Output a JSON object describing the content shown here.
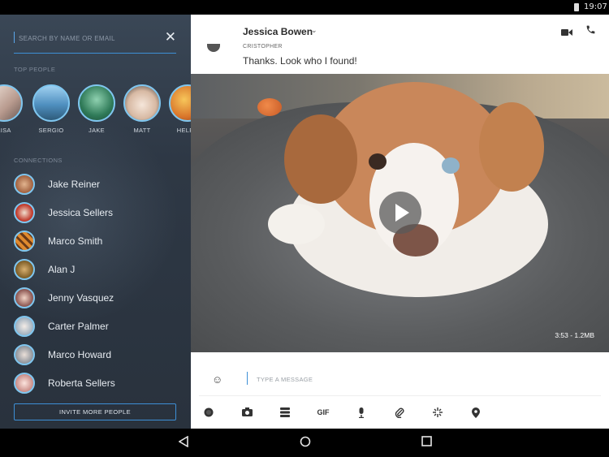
{
  "status": {
    "time": "19:07"
  },
  "left": {
    "search_placeholder": "SEARCH BY NAME OR EMAIL",
    "top_people_label": "TOP PEOPLE",
    "top_people": [
      {
        "name": "LISA",
        "color": "#c9b3a8"
      },
      {
        "name": "SERGIO",
        "color": "#6fa6cf"
      },
      {
        "name": "JAKE",
        "color": "#3f8f6a"
      },
      {
        "name": "MATT",
        "color": "#e9d8cc"
      },
      {
        "name": "HELEN",
        "color": "#d98a3a"
      }
    ],
    "connections_label": "CONNECTIONS",
    "connections": [
      {
        "name": "Jake Reiner",
        "color": "#b06f4b"
      },
      {
        "name": "Jessica Sellers",
        "color": "#c0392b"
      },
      {
        "name": "Marco Smith",
        "color": "#e08a2e"
      },
      {
        "name": "Alan J",
        "color": "#8b6b2e"
      },
      {
        "name": "Jenny Vasquez",
        "color": "#a9746e"
      },
      {
        "name": "Carter Palmer",
        "color": "#cdd6de"
      },
      {
        "name": "Marco Howard",
        "color": "#b7bcc4"
      },
      {
        "name": "Roberta Sellers",
        "color": "#d6a7a0"
      }
    ],
    "invite_label": "INVITE MORE PEOPLE"
  },
  "chat": {
    "title": "Jessica Bowen",
    "sender": "CRISTOPHER",
    "message": "Thanks. Look who I found!",
    "media_duration": "3:53 - 1.2MB",
    "composer_placeholder": "TYPE A MESSAGE",
    "gif_label": "GIF"
  },
  "colors": {
    "accent": "#3d8fd6",
    "panel": "#2e3845"
  }
}
